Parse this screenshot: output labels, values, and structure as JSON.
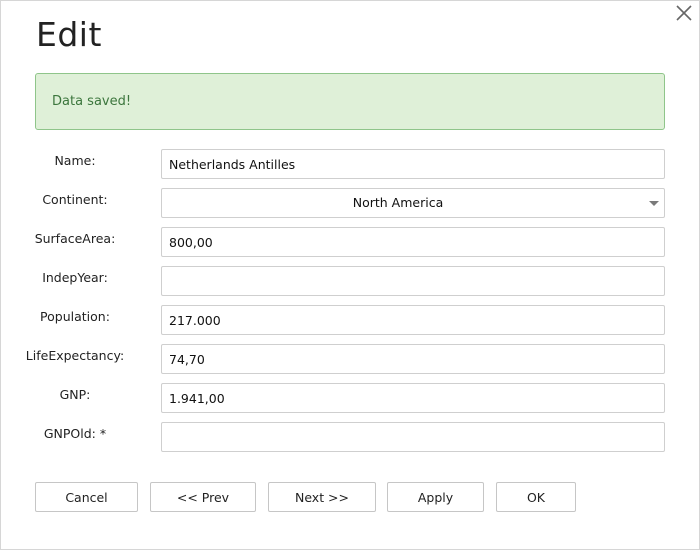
{
  "dialog": {
    "title": "Edit"
  },
  "alert": {
    "message": "Data saved!"
  },
  "fields": {
    "name": {
      "label": "Name:",
      "value": "Netherlands Antilles"
    },
    "continent": {
      "label": "Continent:",
      "value": "North America"
    },
    "surface_area": {
      "label": "SurfaceArea:",
      "value": "800,00"
    },
    "indep_year": {
      "label": "IndepYear:",
      "value": ""
    },
    "population": {
      "label": "Population:",
      "value": "217.000"
    },
    "life_expectancy": {
      "label": "LifeExpectancy:",
      "value": "74,70"
    },
    "gnp": {
      "label": "GNP:",
      "value": "1.941,00"
    },
    "gnp_old": {
      "label": "GNPOld: *",
      "value": ""
    }
  },
  "buttons": {
    "cancel": "Cancel",
    "prev": "<< Prev",
    "next": "Next >>",
    "apply": "Apply",
    "ok": "OK"
  },
  "icons": {
    "close": "close-icon",
    "dropdown": "chevron-down-icon"
  },
  "colors": {
    "alert_bg": "#dff0d8",
    "alert_border": "#8fc58a",
    "alert_text": "#3c763d"
  }
}
